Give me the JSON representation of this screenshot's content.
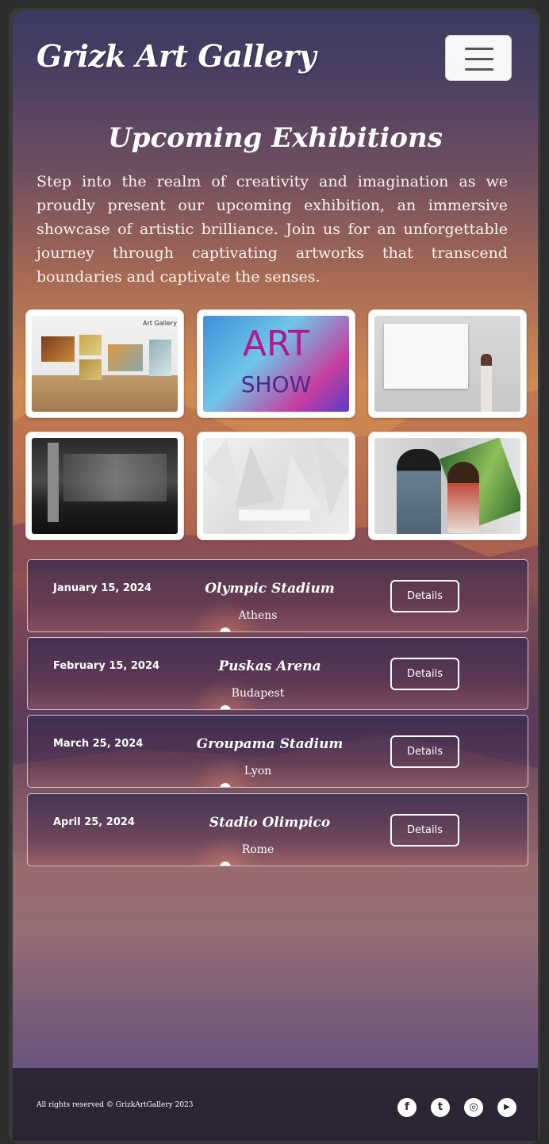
{
  "header": {
    "logo": "Grizk Art Gallery",
    "menu_icon": "hamburger-menu-icon"
  },
  "main": {
    "title": "Upcoming Exhibitions",
    "intro": "Step into the realm of creativity and imagination as we proudly present our upcoming exhibition, an immersive showcase of artistic brilliance. Join us for an unforgettable journey through captivating artworks that transcend boundaries and captivate the senses."
  },
  "gallery": {
    "thumbnails": [
      {
        "name": "gallery-wall-thumbnail",
        "caption": "Art Gallery"
      },
      {
        "name": "art-show-thumbnail",
        "text_line1": "ART",
        "text_line2": "SHOW"
      },
      {
        "name": "blank-canvas-thumbnail"
      },
      {
        "name": "dark-hall-thumbnail"
      },
      {
        "name": "white-sculpture-thumbnail"
      },
      {
        "name": "artists-painting-thumbnail"
      }
    ]
  },
  "events": [
    {
      "date": "January 15, 2024",
      "venue": "Olympic Stadium",
      "city": "Athens",
      "button": "Details"
    },
    {
      "date": "February 15, 2024",
      "venue": "Puskas Arena",
      "city": "Budapest",
      "button": "Details"
    },
    {
      "date": "March 25, 2024",
      "venue": "Groupama Stadium",
      "city": "Lyon",
      "button": "Details"
    },
    {
      "date": "April 25, 2024",
      "venue": "Stadio Olimpico",
      "city": "Rome",
      "button": "Details"
    }
  ],
  "footer": {
    "copyright": "All rights reserved © GrizkArtGallery 2023",
    "social": [
      {
        "icon": "facebook-icon",
        "glyph": "f"
      },
      {
        "icon": "twitter-icon",
        "glyph": "t"
      },
      {
        "icon": "instagram-icon",
        "glyph": "◎"
      },
      {
        "icon": "youtube-icon",
        "glyph": "▶"
      }
    ]
  },
  "colors": {
    "accent": "#ffffff",
    "footer_bg": "#2a2331"
  }
}
